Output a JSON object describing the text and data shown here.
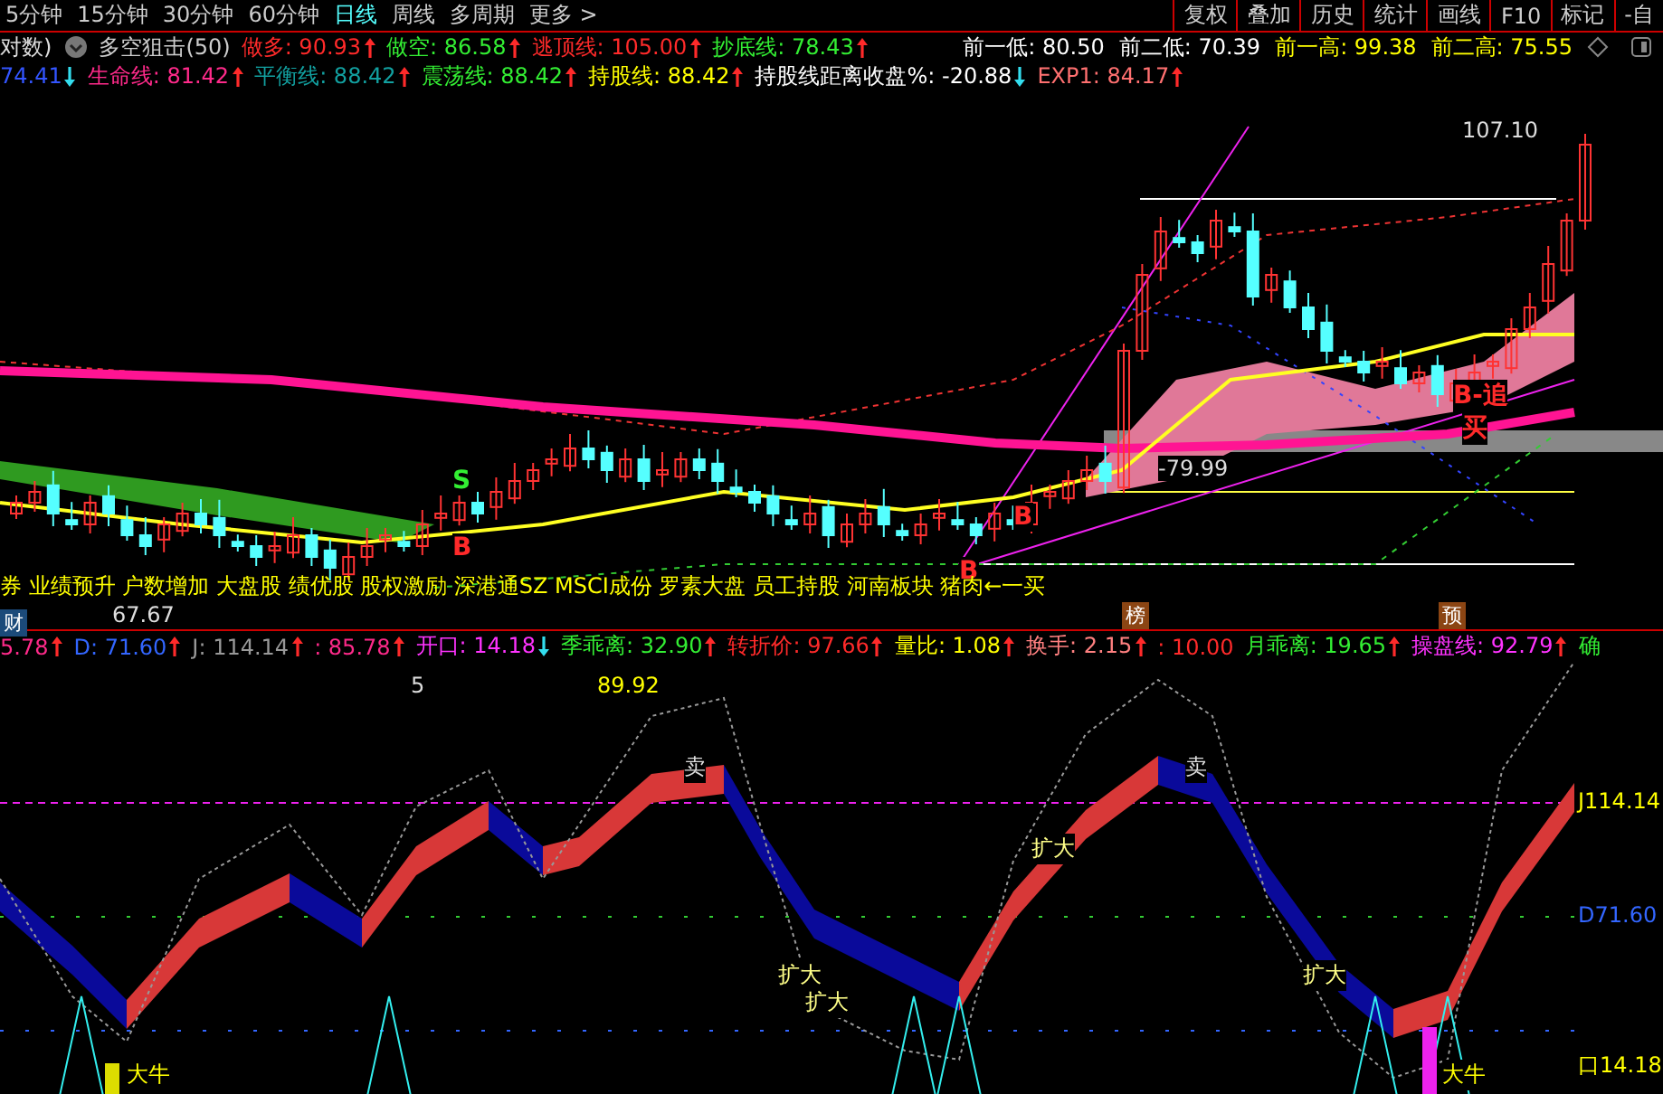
{
  "period_tabs": [
    {
      "label": "5分钟",
      "selected": false
    },
    {
      "label": "15分钟",
      "selected": false
    },
    {
      "label": "30分钟",
      "selected": false
    },
    {
      "label": "60分钟",
      "selected": false
    },
    {
      "label": "日线",
      "selected": true
    },
    {
      "label": "周线",
      "selected": false
    },
    {
      "label": "多周期",
      "selected": false
    },
    {
      "label": "更多 >",
      "selected": false
    }
  ],
  "toolbar_buttons": [
    "复权",
    "叠加",
    "历史",
    "统计",
    "画线",
    "F10",
    "标记",
    "-自"
  ],
  "indicator_row_1": {
    "prefix": "对数)",
    "title": "多空狙击(50)",
    "values": [
      {
        "text": "做多: 90.93",
        "color": "#ff2a2a",
        "rising": true
      },
      {
        "text": "做空: 86.58",
        "color": "#33ee33",
        "rising": true
      },
      {
        "text": "逃顶线: 105.00",
        "color": "#ff2a2a",
        "rising": true
      },
      {
        "text": "抄底线: 78.43",
        "color": "#33ee33",
        "rising": true
      }
    ]
  },
  "prev_levels": [
    {
      "text": "前一低: 80.50",
      "color": "#ffffff"
    },
    {
      "text": "前二低: 70.39",
      "color": "#ffffff"
    },
    {
      "text": "前一高: 99.38",
      "color": "#ffff00"
    },
    {
      "text": "前二高: 75.55",
      "color": "#ffff00"
    }
  ],
  "indicator_row_2": [
    {
      "text": "74.41",
      "color": "#3355ff",
      "rising": false
    },
    {
      "text": "生命线: 81.42",
      "color": "#ff2a8a",
      "rising": true
    },
    {
      "text": "平衡线: 88.42",
      "color": "#12a0a0",
      "rising": true
    },
    {
      "text": "震荡线: 88.42",
      "color": "#33ee33",
      "rising": true
    },
    {
      "text": "持股线: 88.42",
      "color": "#ffff00",
      "rising": true
    },
    {
      "text": "持股线距离收盘%: -20.88",
      "color": "#ffffff",
      "rising": false
    },
    {
      "text": "EXP1: 84.17",
      "color": "#ff7070",
      "rising": true
    }
  ],
  "main_chart": {
    "high_label": "107.10",
    "low_label": "67.67",
    "level_label": "-79.99",
    "signals": [
      {
        "text": "S",
        "kind": "sell"
      },
      {
        "text": "B",
        "kind": "buy"
      },
      {
        "text": "B",
        "kind": "buy"
      },
      {
        "text": "B",
        "kind": "buy"
      },
      {
        "text": "B-追",
        "kind": "buy"
      },
      {
        "text": "买",
        "kind": "buy"
      }
    ],
    "concept_tags": "券 业绩预升 户数增加 大盘股 绩优股 股权激励 深港通SZ MSCI成份 罗素大盘 员工持股 河南板块 猪肉←一买",
    "badges": [
      "财",
      "榜",
      "预"
    ]
  },
  "lower_indicator_row": [
    {
      "text": "5.78",
      "color": "#ff2a8a",
      "rising": true
    },
    {
      "text": "D: 71.60",
      "color": "#3366ff",
      "rising": true
    },
    {
      "text": "J: 114.14",
      "color": "#999999",
      "rising": true
    },
    {
      "text": ": 85.78",
      "color": "#ff2a8a",
      "rising": true
    },
    {
      "text": "开口: 14.18",
      "color": "#ff33ff",
      "rising": false
    },
    {
      "text": "季乖离: 32.90",
      "color": "#33ee33",
      "rising": true
    },
    {
      "text": "转折价: 97.66",
      "color": "#ff2a2a",
      "rising": true
    },
    {
      "text": "量比: 1.08",
      "color": "#ffff00",
      "rising": true
    },
    {
      "text": "换手: 2.15",
      "color": "#ff8080",
      "rising": true
    },
    {
      "text": ": 10.00",
      "color": "#ff2a2a"
    },
    {
      "text": "月乖离: 19.65",
      "color": "#33ee33",
      "rising": true
    },
    {
      "text": "操盘线: 92.79",
      "color": "#ff33ff",
      "rising": true
    },
    {
      "text": "确",
      "color": "#33ee33"
    }
  ],
  "lower_chart": {
    "top_number": "5",
    "peak_value": "89.92",
    "sell_marks": [
      "卖",
      "卖"
    ],
    "expand_marks": [
      "扩大",
      "扩大",
      "扩大",
      "扩大"
    ],
    "bull_marks": [
      "大牛",
      "大牛"
    ],
    "axis_labels": [
      {
        "text": "J114.14",
        "color": "#ffff00"
      },
      {
        "text": "D71.60",
        "color": "#3366ff"
      },
      {
        "text": "口14.18",
        "color": "#ffff00"
      }
    ]
  }
}
